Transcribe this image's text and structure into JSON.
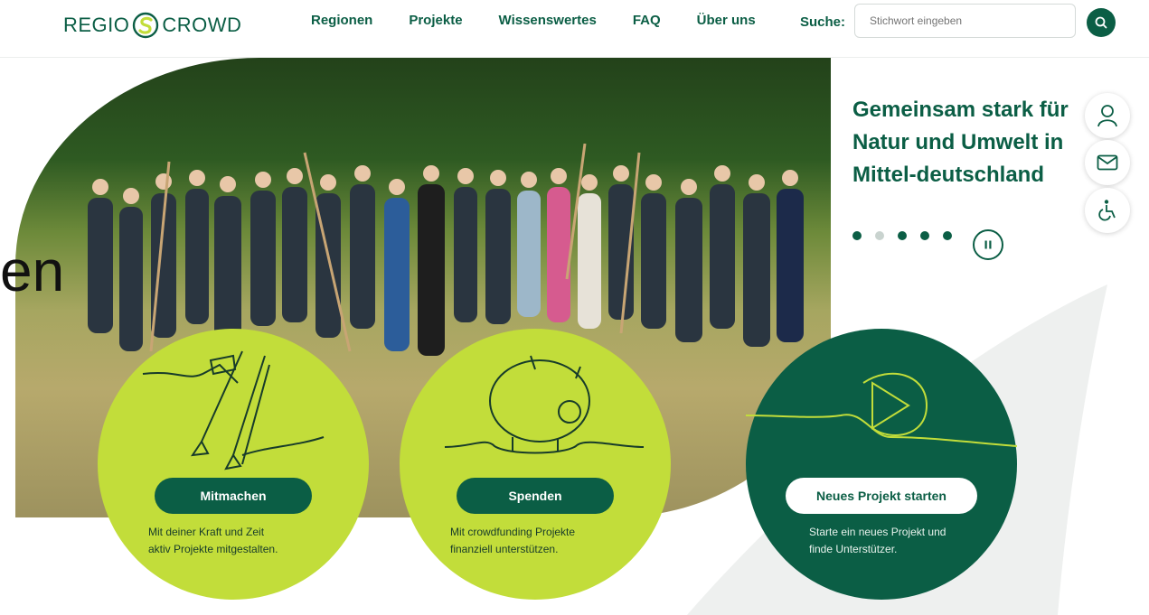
{
  "header": {
    "logo_left": "REGIO",
    "logo_right": "CROWD",
    "nav": [
      "Regionen",
      "Projekte",
      "Wissenswertes",
      "FAQ",
      "Über uns"
    ],
    "search_label": "Suche:",
    "search_placeholder": "Stichwort eingeben"
  },
  "hero": {
    "stray_text": "en",
    "tagline": "Gemeinsam stark für Natur und Umwelt in Mittel-deutschland",
    "carousel": {
      "slides": 5,
      "active_index": 0
    }
  },
  "cards": [
    {
      "label": "Mitmachen",
      "desc_line1": "Mit deiner Kraft und Zeit",
      "desc_line2": "aktiv Projekte mitgestalten."
    },
    {
      "label": "Spenden",
      "desc_line1": "Mit crowdfunding Projekte",
      "desc_line2": "finanziell unterstützen."
    },
    {
      "label": "Neues Projekt starten",
      "desc_line1": "Starte ein neues Projekt und",
      "desc_line2": "finde Unterstützer."
    }
  ],
  "side_actions": [
    "user-icon",
    "mail-icon",
    "accessibility-icon"
  ],
  "colors": {
    "brand_green": "#0b5e45",
    "lime": "#c2dd3a",
    "inactive_dot": "#c9d3cf"
  }
}
